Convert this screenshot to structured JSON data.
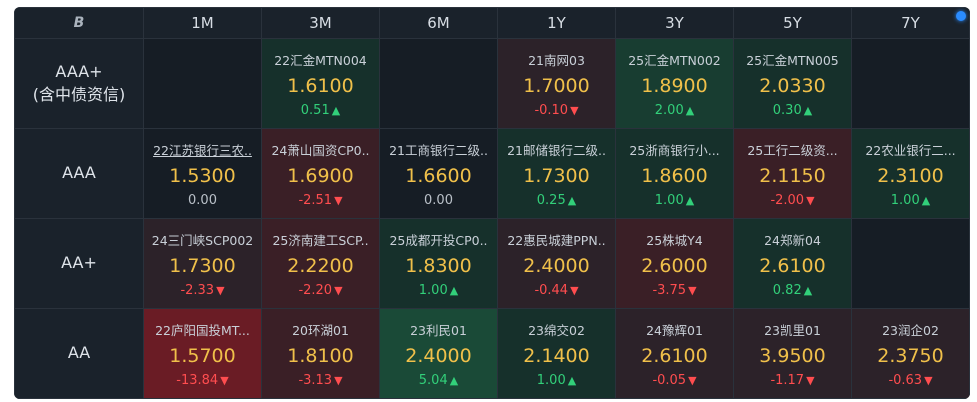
{
  "header": {
    "corner_icon": "B",
    "tenors": [
      "1M",
      "3M",
      "6M",
      "1Y",
      "3Y",
      "5Y",
      "7Y"
    ]
  },
  "rows": [
    {
      "rating": "AAA+\n(含中债资信)",
      "cells": [
        {
          "empty": true
        },
        {
          "name": "22汇金MTN004",
          "yield": "1.6100",
          "change": "0.51",
          "dir": "up",
          "bg": "g1"
        },
        {
          "empty": true
        },
        {
          "name": "21南网03",
          "yield": "1.7000",
          "change": "-0.10",
          "dir": "down",
          "bg": "r1"
        },
        {
          "name": "25汇金MTN002",
          "yield": "1.8900",
          "change": "2.00",
          "dir": "up",
          "bg": "g2"
        },
        {
          "name": "25汇金MTN005",
          "yield": "2.0330",
          "change": "0.30",
          "dir": "up",
          "bg": "g1"
        },
        {
          "empty": true
        }
      ]
    },
    {
      "rating": "AAA",
      "cells": [
        {
          "name": "22江苏银行三农..",
          "yield": "1.5300",
          "change": "0.00",
          "dir": "flat",
          "bg": "n",
          "link": true
        },
        {
          "name": "24萧山国资CP0..",
          "yield": "1.6900",
          "change": "-2.51",
          "dir": "down",
          "bg": "r2"
        },
        {
          "name": "21工商银行二级..",
          "yield": "1.6600",
          "change": "0.00",
          "dir": "flat",
          "bg": "n"
        },
        {
          "name": "21邮储银行二级..",
          "yield": "1.7300",
          "change": "0.25",
          "dir": "up",
          "bg": "g1"
        },
        {
          "name": "25浙商银行小...",
          "yield": "1.8600",
          "change": "1.00",
          "dir": "up",
          "bg": "g1"
        },
        {
          "name": "25工行二级资...",
          "yield": "2.1150",
          "change": "-2.00",
          "dir": "down",
          "bg": "r2"
        },
        {
          "name": "22农业银行二...",
          "yield": "2.3100",
          "change": "1.00",
          "dir": "up",
          "bg": "g1"
        }
      ]
    },
    {
      "rating": "AA+",
      "cells": [
        {
          "name": "24三门峡SCP002",
          "yield": "1.7300",
          "change": "-2.33",
          "dir": "down",
          "bg": "r1"
        },
        {
          "name": "25济南建工SCP..",
          "yield": "2.2200",
          "change": "-2.20",
          "dir": "down",
          "bg": "r2"
        },
        {
          "name": "25成都开投CP0..",
          "yield": "1.8300",
          "change": "1.00",
          "dir": "up",
          "bg": "g1"
        },
        {
          "name": "22惠民城建PPN..",
          "yield": "2.4000",
          "change": "-0.44",
          "dir": "down",
          "bg": "r1"
        },
        {
          "name": "25株城Y4",
          "yield": "2.6000",
          "change": "-3.75",
          "dir": "down",
          "bg": "r2"
        },
        {
          "name": "24郑新04",
          "yield": "2.6100",
          "change": "0.82",
          "dir": "up",
          "bg": "g1"
        },
        {
          "empty": true
        }
      ]
    },
    {
      "rating": "AA",
      "cells": [
        {
          "name": "22庐阳国投MT...",
          "yield": "1.5700",
          "change": "-13.84",
          "dir": "down",
          "bg": "r3"
        },
        {
          "name": "20环湖01",
          "yield": "1.8100",
          "change": "-3.13",
          "dir": "down",
          "bg": "r2"
        },
        {
          "name": "23利民01",
          "yield": "2.4000",
          "change": "5.04",
          "dir": "up",
          "bg": "g3"
        },
        {
          "name": "23绵交02",
          "yield": "2.1400",
          "change": "1.00",
          "dir": "up",
          "bg": "g1"
        },
        {
          "name": "24豫辉01",
          "yield": "2.6100",
          "change": "-0.05",
          "dir": "down",
          "bg": "r1"
        },
        {
          "name": "23凯里01",
          "yield": "3.9500",
          "change": "-1.17",
          "dir": "down",
          "bg": "r1"
        },
        {
          "name": "23润企02",
          "yield": "2.3750",
          "change": "-0.63",
          "dir": "down",
          "bg": "r1"
        }
      ]
    }
  ]
}
